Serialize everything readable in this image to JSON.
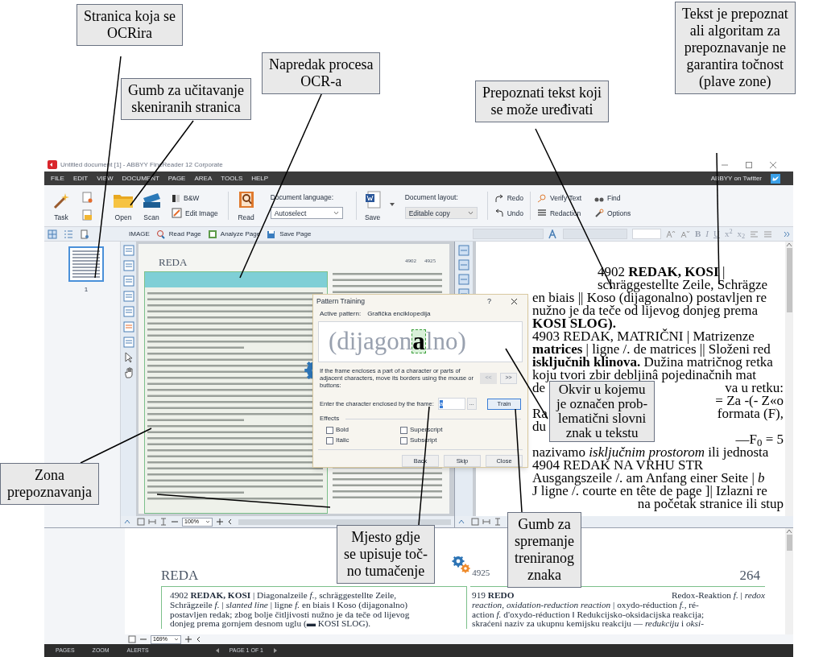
{
  "window": {
    "title": "Untitled document [1] - ABBYY FineReader 12 Corporate"
  },
  "menu": [
    "FILE",
    "EDIT",
    "VIEW",
    "DOCUMENT",
    "PAGE",
    "AREA",
    "TOOLS",
    "HELP"
  ],
  "twitter": "ABBYY on Twitter",
  "ribbon": {
    "task": "Task",
    "open": "Open",
    "scan": "Scan",
    "bw": "B&W",
    "edit_image": "Edit Image",
    "read": "Read",
    "language_label": "Document language:",
    "language_value": "Autoselect",
    "save": "Save",
    "layout_label": "Document layout:",
    "layout_value": "Editable copy",
    "redo": "Redo",
    "undo": "Undo",
    "verify": "Verify Text",
    "find": "Find",
    "redaction": "Redaction",
    "options": "Options"
  },
  "pages_pane": {
    "thumbnail_label": "1"
  },
  "image_pane": {
    "toolbar_label": "IMAGE",
    "buttons": [
      "Read Page",
      "Analyze Page",
      "Save Page"
    ],
    "header": "REDA",
    "page_numbers": [
      "4902",
      "4925"
    ],
    "zoom": "100%"
  },
  "text_pane": {
    "format_buttons": [
      "B",
      "I",
      "U",
      "x$^{2}$",
      "x$_{2}$"
    ],
    "lines": [
      {
        "indent": true,
        "left": "4902 **REDAK, KOSI** |"
      },
      {
        "indent": true,
        "left": "schräggestellte Zeile, Schrägze"
      },
      {
        "left": "en biais || Koso (dijagonalno) postavljen re"
      },
      {
        "left": "nužno je da teče od lijevog donjeg prema"
      },
      {
        "left": "**KOSI SLOG).**"
      },
      {
        "left": "4903 REDAK, MATRIČNI | Matrizenze"
      },
      {
        "left": "**matrices** | ligne /. de matrices || Složeni red"
      },
      {
        "left": "**isključnih klinova.** Dužina matričnog retka"
      },
      {
        "left": "koju tvori zbir debljinâ pojedinačnih mat"
      },
      {
        "left": "de",
        "right": "va u retku:"
      },
      {
        "right": "= Za -(- Z«o"
      },
      {
        "left": "Ra",
        "right": "formata (F),"
      },
      {
        "left": "du"
      },
      {
        "right": "—F$_{0}$ = 5"
      },
      {
        "left": "nazivamo *isključnim prostorom* ili jednosta"
      },
      {
        "left": "4904 REDAK NA VRHU STR"
      },
      {
        "left": "Ausgangszeile /. am Anfang einer Seite | *b*"
      },
      {
        "left": "J ligne /. courte en tête de page ]| Izlazni re"
      },
      {
        "right": "na početak stranice ili stup"
      }
    ]
  },
  "zoom_pane": {
    "header": "REDA",
    "page_number": "4925",
    "right_number": "264",
    "zoom": "169%",
    "left_lines": [
      "4902 **REDAK, KOSI** | Diagonalzeile *f.*, schräggestellte Zeile,",
      "Schrägzeile *f.* | *slanted line* | ligne *f.* en biais ‖ Koso (dijagonalno)",
      "postavljen redak; zbog bolje čitljivosti nužno je da teče od lijevog",
      "donjeg prema gornjem desnom uglu (▬ KOSI SLOG)."
    ],
    "right_lines": [
      {
        "left": "919 **REDO**",
        "right": "Redox-Reaktion *f.* | *redox*"
      },
      {
        "left": "*reaction, oxidation-reduction reaction* | oxydo-réduction *f.*, ré-"
      },
      {
        "left": "action *f.* d'oxydo-réduction ‖ Redukcijsko-oksidacijska reakcija;"
      },
      {
        "left": "skraćeni naziv za ukupnu kemijsku reakciju — *redukciju* i *oksi-*"
      }
    ]
  },
  "status_bar": {
    "tabs": [
      "PAGES",
      "ZOOM",
      "ALERTS"
    ],
    "page": "PAGE 1 OF 1"
  },
  "dialog": {
    "title": "Pattern Training",
    "help": "?",
    "active_label": "Active pattern:",
    "active_value": "Grafička enciklopedija",
    "preview_before": "(dijagon",
    "preview_char": "a",
    "preview_after": "lno)",
    "hint": "If the frame encloses a part of a character or parts of adjacent characters, move its borders using the mouse or buttons:",
    "nav": [
      {
        "label": "<<",
        "disabled": true
      },
      {
        "label": ">>",
        "disabled": false
      }
    ],
    "enter_label": "Enter the character enclosed by the frame:",
    "enter_value": "a",
    "more": "...",
    "train": "Train",
    "effects_label": "Effects",
    "effects": [
      {
        "label": "Bold",
        "checked": false
      },
      {
        "label": "Superscript",
        "checked": false
      },
      {
        "label": "Italic",
        "checked": false
      },
      {
        "label": "Subscript",
        "checked": false
      }
    ],
    "buttons": [
      "Back",
      "Skip",
      "Close"
    ]
  },
  "callouts": [
    "Stranica koja se\nOCRira",
    "Gumb za učitavanje\nskeniranih stranica",
    "Napredak procesa\nOCR-a",
    "Prepoznati tekst koji\nse može uređivati",
    "Tekst je prepoznat\nali algoritam za\nprepoznavanje ne\ngarantira točnost\n(plave zone)",
    "Zona\nprepoznavanja",
    "Mjesto gdje\nse upisuje toč-\nno tumačenje",
    "Okvir u kojemu\nje označen prob-\nlematični slovni\nznak u tekstu",
    "Gumb za\nspremanje\ntreniranog\nznaka"
  ]
}
